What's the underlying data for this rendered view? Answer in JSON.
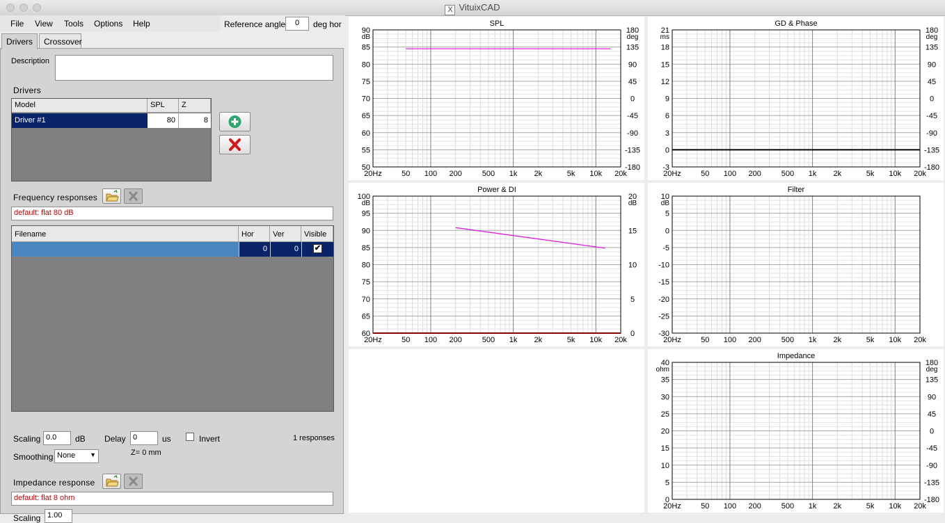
{
  "window": {
    "title": "VituixCAD"
  },
  "menu": [
    "File",
    "View",
    "Tools",
    "Options",
    "Help"
  ],
  "reference_angle": {
    "label": "Reference angle",
    "value": "0",
    "unit": "deg hor"
  },
  "tabs": [
    "Drivers",
    "Crossover"
  ],
  "description": {
    "label": "Description",
    "value": ""
  },
  "drivers": {
    "title": "Drivers",
    "columns": [
      "Model",
      "SPL",
      "Z"
    ],
    "rows": [
      {
        "model": "Driver #1",
        "spl": "80",
        "z": "8"
      }
    ]
  },
  "freq_responses": {
    "title": "Frequency responses",
    "default_text": "default: flat 80 dB",
    "columns": [
      "Filename",
      "Hor",
      "Ver",
      "Visible"
    ],
    "rows": [
      {
        "filename": "",
        "hor": "0",
        "ver": "0",
        "visible": true
      }
    ],
    "scaling_label": "Scaling",
    "scaling_value": "0.0",
    "scaling_unit": "dB",
    "delay_label": "Delay",
    "delay_value": "0",
    "delay_unit": "us",
    "invert_label": "Invert",
    "responses_count": "1 responses",
    "smoothing_label": "Smoothing",
    "smoothing_value": "None",
    "z_label": "Z= 0 mm"
  },
  "impedance": {
    "title": "Impedance response",
    "default_text": "default: flat 8 ohm",
    "scaling_label": "Scaling",
    "scaling_value": "1.00"
  },
  "colors": {
    "accent_red": "#c00000",
    "selection": "#0a246a",
    "magenta": "#e020e0",
    "dark_red": "#8b0000"
  },
  "chart_data": [
    {
      "title": "SPL",
      "type": "line",
      "x_ticks": [
        "20Hz",
        "50",
        "100",
        "200",
        "500",
        "1k",
        "2k",
        "5k",
        "10k",
        "20k"
      ],
      "y_unit": "dB",
      "y_ticks": [
        "90",
        "85",
        "80",
        "75",
        "70",
        "65",
        "60",
        "55",
        "50"
      ],
      "ylim": [
        50,
        90
      ],
      "y2_unit": "deg",
      "y2_ticks": [
        "180",
        "135",
        "90",
        "45",
        "0",
        "-45",
        "-90",
        "-135",
        "-180"
      ],
      "y2lim": [
        -180,
        180
      ],
      "series": [
        {
          "color": "#e020e0",
          "x": [
            50,
            15000
          ],
          "y": [
            84.5,
            84.5
          ],
          "axis": "left"
        }
      ]
    },
    {
      "title": "GD & Phase",
      "type": "line",
      "x_ticks": [
        "20Hz",
        "50",
        "100",
        "200",
        "500",
        "1k",
        "2k",
        "5k",
        "10k",
        "20k"
      ],
      "y_unit": "ms",
      "y_ticks": [
        "21",
        "18",
        "15",
        "12",
        "9",
        "6",
        "3",
        "0",
        "-3"
      ],
      "ylim": [
        -3,
        21
      ],
      "y2_unit": "deg",
      "y2_ticks": [
        "180",
        "135",
        "90",
        "45",
        "0",
        "-45",
        "-90",
        "-135",
        "-180"
      ],
      "y2lim": [
        -180,
        180
      ],
      "series": [
        {
          "color": "#000000",
          "x": [
            20,
            20000
          ],
          "y": [
            0,
            0
          ],
          "axis": "left",
          "width": 2
        }
      ]
    },
    {
      "title": "Power & DI",
      "type": "line",
      "x_ticks": [
        "20Hz",
        "50",
        "100",
        "200",
        "500",
        "1k",
        "2k",
        "5k",
        "10k",
        "20k"
      ],
      "y_unit": "dB",
      "y_ticks": [
        "100",
        "95",
        "90",
        "85",
        "80",
        "75",
        "70",
        "65",
        "60"
      ],
      "ylim": [
        60,
        100
      ],
      "y2_unit": "dB",
      "y2_ticks": [
        "20",
        "15",
        "10",
        "5",
        "0"
      ],
      "y2lim": [
        0,
        20
      ],
      "series": [
        {
          "color": "#e020e0",
          "x": [
            200,
            13000
          ],
          "y": [
            90.8,
            84.8
          ],
          "axis": "left"
        },
        {
          "color": "#8b0000",
          "x": [
            20,
            20000
          ],
          "y": [
            0,
            0
          ],
          "axis": "right",
          "width": 2
        }
      ]
    },
    {
      "title": "Filter",
      "type": "line",
      "x_ticks": [
        "20Hz",
        "50",
        "100",
        "200",
        "500",
        "1k",
        "2k",
        "5k",
        "10k",
        "20k"
      ],
      "y_unit": "dB",
      "y_ticks": [
        "10",
        "5",
        "0",
        "-5",
        "-10",
        "-15",
        "-20",
        "-25",
        "-30"
      ],
      "ylim": [
        -30,
        10
      ],
      "y2_unit": "",
      "y2_ticks": [],
      "y2lim": null,
      "series": []
    },
    {
      "title": "Impedance",
      "type": "line",
      "x_ticks": [
        "20Hz",
        "50",
        "100",
        "200",
        "500",
        "1k",
        "2k",
        "5k",
        "10k",
        "20k"
      ],
      "y_unit": "ohm",
      "y_ticks": [
        "40",
        "35",
        "30",
        "25",
        "20",
        "15",
        "10",
        "5",
        "0"
      ],
      "ylim": [
        0,
        40
      ],
      "y2_unit": "deg",
      "y2_ticks": [
        "180",
        "135",
        "90",
        "45",
        "0",
        "-45",
        "-90",
        "-135",
        "-180"
      ],
      "y2lim": [
        -180,
        180
      ],
      "series": []
    }
  ]
}
